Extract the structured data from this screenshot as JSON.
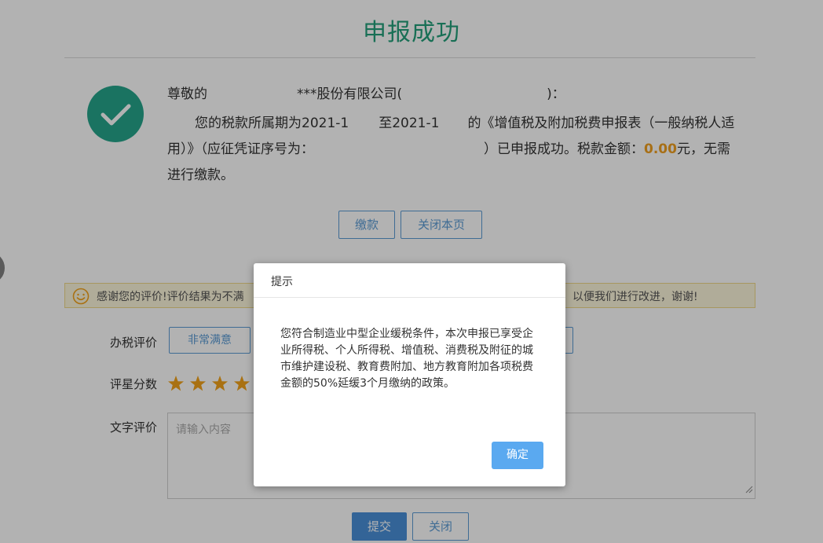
{
  "page": {
    "title": "申报成功",
    "greeting_prefix": "尊敬的",
    "company_suffix": "***股份有限公司(",
    "greeting_end": ")：",
    "period_prefix": "您的税款所属期为2021-1",
    "period_mid": "至2021-1",
    "form_name": "的《增值税及附加税费申报表（一般纳税人适",
    "line3_prefix": "用）》（应征凭证序号为：",
    "line3_mid": "）已申报成功。税款金额：",
    "amount": "0.00",
    "line3_suffix": "元，无需",
    "line4": "进行缴款。"
  },
  "actions": {
    "pay_label": "缴款",
    "close_page_label": "关闭本页"
  },
  "feedback": {
    "notice_left": "感谢您的评价!评价结果为不满",
    "notice_right": "以便我们进行改进，谢谢!",
    "rating_label": "办税评价",
    "rating_option": "非常满意",
    "score_label": "评星分数",
    "stars": 4,
    "text_label": "文字评价",
    "text_placeholder": "请输入内容",
    "submit_label": "提交",
    "close_label": "关闭"
  },
  "dialog": {
    "title": "提示",
    "message": "您符合制造业中型企业缓税条件，本次申报已享受企业所得税、个人所得税、增值税、消费税及附征的城市维护建设税、教育费附加、地方教育附加各项税费金额的50%延缓3个月缴纳的政策。",
    "ok_label": "确定"
  },
  "colors": {
    "title": "#23a07a",
    "check": "#26a58b",
    "accent": "#5b9bd5",
    "amount": "#f0a020",
    "star": "#f2a31b",
    "ok_button": "#5aa9f0"
  },
  "icons": {
    "success": "check-circle-icon",
    "notice": "smile-icon",
    "star": "star-icon",
    "resize": "resize-grip-icon"
  }
}
